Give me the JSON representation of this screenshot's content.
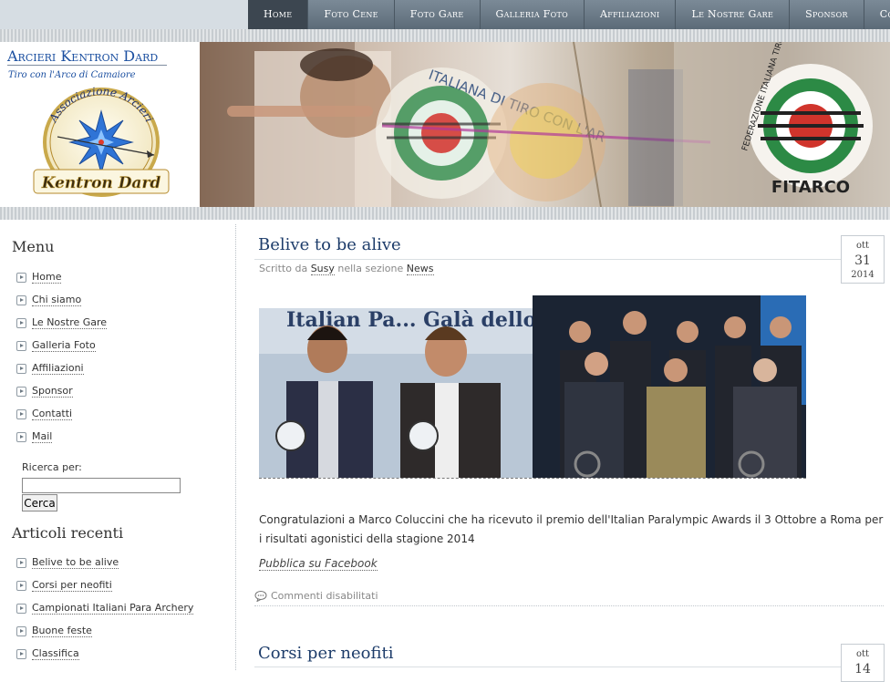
{
  "nav": {
    "items": [
      "Home",
      "Foto Cene",
      "Foto Gare",
      "Galleria Foto",
      "Affiliazioni",
      "Le Nostre Gare",
      "Sponsor",
      "Contatti"
    ],
    "active": "Home"
  },
  "header": {
    "site_title": "Arcieri Kentron Dard",
    "tagline": "Tiro con l'Arco di Camaiore",
    "logo": {
      "arc_text": "Associazione Arcieri",
      "name": "Kentron Dard"
    },
    "banner": {
      "federation_text": "FEDERAZIONE ITALIANA TIRO CON L'ARCO",
      "federation_abbr": "FITARCO",
      "target_text": "ITALIANA DI TIRO CON L'AR"
    }
  },
  "sidebar": {
    "menu_heading": "Menu",
    "menu_items": [
      "Home",
      "Chi siamo",
      "Le Nostre Gare",
      "Galleria Foto",
      "Affiliazioni",
      "Sponsor",
      "Contatti",
      "Mail"
    ],
    "search_label": "Ricerca per:",
    "search_value": "",
    "search_button": "Cerca",
    "recent_heading": "Articoli recenti",
    "recent_items": [
      "Belive to be alive",
      "Corsi per neofiti",
      "Campionati Italiani Para Archery",
      "Buone feste",
      "Classifica"
    ]
  },
  "posts": [
    {
      "title": "Belive to be alive",
      "meta_prefix": "Scritto da",
      "author": "Susy",
      "meta_mid": "nella sezione",
      "category": "News",
      "date": {
        "month": "ott",
        "day": "31",
        "year": "2014"
      },
      "image_caption_text": "Italian Pa... Galà dello Sport Parali",
      "body": "Congratulazioni a Marco Coluccini che ha ricevuto il premio dell'Italian Paralympic Awards il 3 Ottobre a Roma per i risultati agonistici della stagione 2014",
      "share": "Pubblica su Facebook",
      "comments": "Commenti disabilitati"
    },
    {
      "title": "Corsi per neofiti",
      "date": {
        "month": "ott",
        "day": "14"
      }
    }
  ],
  "colors": {
    "nav_bg": "#5c6b78",
    "nav_active": "#3c4650",
    "title_blue": "#1b4fa0",
    "post_title": "#1d3c6a"
  }
}
